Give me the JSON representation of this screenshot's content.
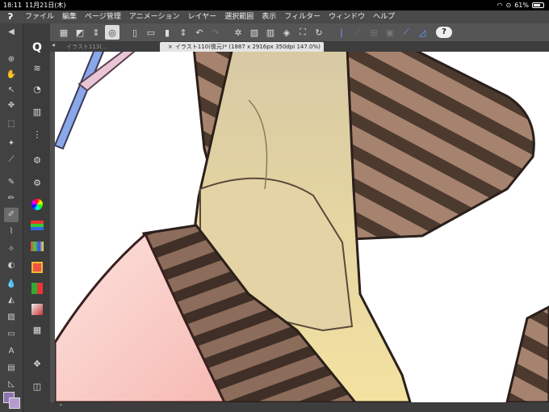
{
  "status": {
    "time": "18:11",
    "date": "11月21日(木)",
    "battery": "61%",
    "battery_level": 0.61
  },
  "menu": {
    "logo": "ʔ",
    "items": [
      "ファイル",
      "編集",
      "ページ管理",
      "アニメーション",
      "レイヤー",
      "選択範囲",
      "表示",
      "フィルター",
      "ウィンドウ",
      "ヘルプ"
    ]
  },
  "tabs": {
    "inactive_label": "イラスト113(…",
    "active_label": "イラスト110(復元)* (1887 x 2916px 350dpi 147.0%)",
    "close_glyph": "×"
  },
  "help_label": "?",
  "colors": {
    "main": "#8e72b0",
    "sub": "#b79ad0"
  },
  "bottom": {
    "collapse_glyph": "⌃"
  }
}
